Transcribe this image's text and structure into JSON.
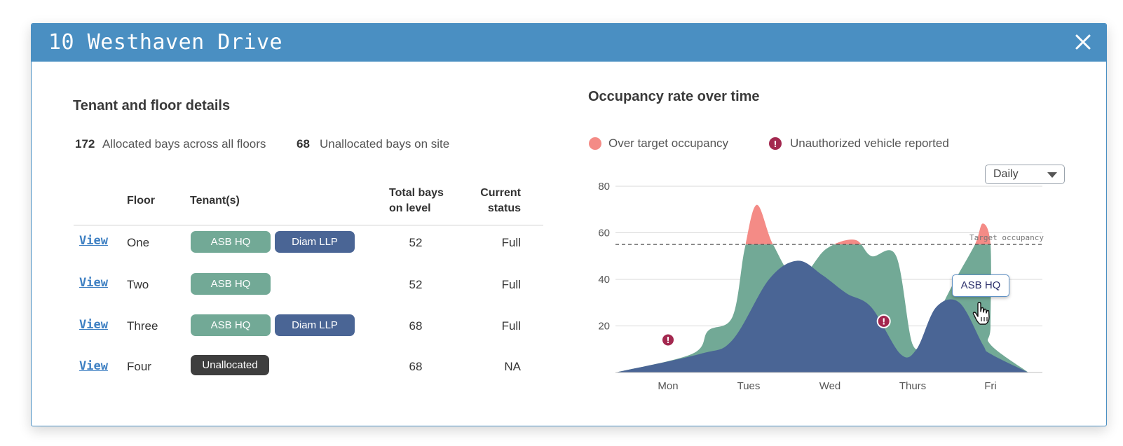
{
  "modal": {
    "title": "10 Westhaven Drive",
    "close_icon": "close-icon"
  },
  "tenant_section": {
    "title": "Tenant and floor details",
    "stats": [
      {
        "value": "172",
        "label": "Allocated bays across all floors"
      },
      {
        "value": "68",
        "label": "Unallocated bays on site"
      }
    ],
    "table": {
      "headers": {
        "floor": "Floor",
        "tenants": "Tenant(s)",
        "total_line1": "Total bays",
        "total_line2": "on level",
        "status_line1": "Current",
        "status_line2": "status"
      },
      "rows": [
        {
          "link": "View",
          "floor": "One",
          "tenants": [
            "ASB HQ",
            "Diam LLP"
          ],
          "total": "52",
          "status": "Full"
        },
        {
          "link": "View",
          "floor": "Two",
          "tenants": [
            "ASB HQ"
          ],
          "total": "52",
          "status": "Full"
        },
        {
          "link": "View",
          "floor": "Three",
          "tenants": [
            "ASB HQ",
            "Diam LLP"
          ],
          "total": "68",
          "status": "Full"
        },
        {
          "link": "View",
          "floor": "Four",
          "tenants": [
            "Unallocated"
          ],
          "total": "68",
          "status": "NA"
        }
      ]
    }
  },
  "occupancy_section": {
    "title": "Occupancy rate over time",
    "legend": [
      {
        "label": "Over target occupancy",
        "color": "#f48b86"
      },
      {
        "label": "Unauthorized vehicle reported",
        "color": "#a3284f",
        "icon": "alert-icon"
      }
    ],
    "dropdown": {
      "selected": "Daily"
    },
    "tooltip": "ASB HQ"
  },
  "colors": {
    "header": "#4a8fc2",
    "green": "#72a996",
    "blue": "#4a6595",
    "over_target": "#f48b86",
    "alert": "#a3284f",
    "link": "#3d7fc2"
  },
  "chart_data": {
    "type": "area",
    "categories": [
      "Mon",
      "Tues",
      "Wed",
      "Thurs",
      "Fri"
    ],
    "y_ticks": [
      "20",
      "40",
      "60",
      "80"
    ],
    "ylim": [
      0,
      80
    ],
    "target": {
      "label": "Target occupancy",
      "value": 55
    },
    "series": [
      {
        "name": "ASB HQ",
        "color": "#72a996",
        "points": [
          [
            0,
            0
          ],
          [
            0.3,
            8
          ],
          [
            0.5,
            18
          ],
          [
            0.8,
            24
          ],
          [
            0.95,
            53
          ],
          [
            1.1,
            72
          ],
          [
            1.3,
            55
          ],
          [
            1.6,
            40
          ],
          [
            1.95,
            53
          ],
          [
            2.3,
            57
          ],
          [
            2.5,
            50
          ],
          [
            2.8,
            50
          ],
          [
            3.0,
            12
          ],
          [
            3.2,
            18
          ],
          [
            3.55,
            40
          ],
          [
            3.8,
            55
          ],
          [
            3.9,
            64
          ],
          [
            4.1,
            55
          ],
          [
            4.3,
            20
          ],
          [
            4.6,
            12
          ],
          [
            4.85,
            0
          ]
        ]
      },
      {
        "name": "",
        "color": "#4a6595",
        "points": [
          [
            0,
            0
          ],
          [
            0.4,
            8
          ],
          [
            0.8,
            14
          ],
          [
            1.25,
            40
          ],
          [
            1.6,
            48
          ],
          [
            1.9,
            42
          ],
          [
            2.2,
            34
          ],
          [
            2.5,
            28
          ],
          [
            2.85,
            8
          ],
          [
            3.05,
            10
          ],
          [
            3.3,
            28
          ],
          [
            3.6,
            30
          ],
          [
            3.9,
            12
          ],
          [
            4.3,
            8
          ],
          [
            4.85,
            0
          ]
        ]
      }
    ],
    "alerts": [
      {
        "x": 0.0,
        "y": 14
      },
      {
        "x": 2.65,
        "y": 22
      }
    ]
  }
}
